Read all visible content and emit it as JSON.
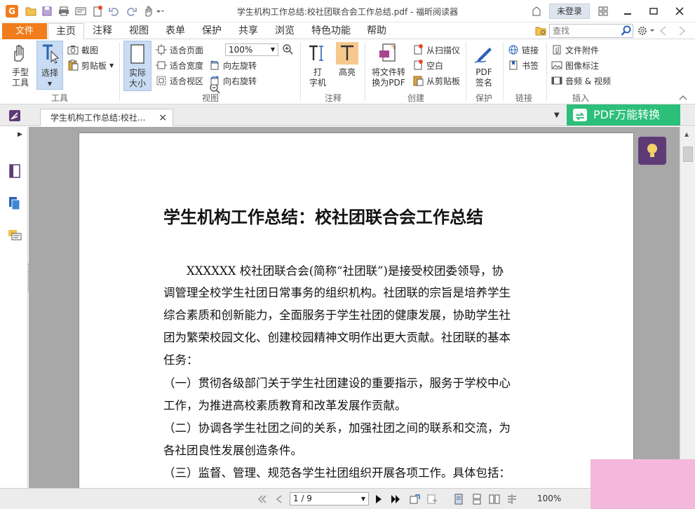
{
  "window": {
    "title": "学生机构工作总结:校社团联合会工作总结.pdf - 福昕阅读器",
    "login_label": "未登录",
    "logo_letter": "G"
  },
  "menu": {
    "file_label": "文件",
    "tabs": [
      {
        "label": "主页",
        "active": true
      },
      {
        "label": "注释",
        "active": false
      },
      {
        "label": "视图",
        "active": false
      },
      {
        "label": "表单",
        "active": false
      },
      {
        "label": "保护",
        "active": false
      },
      {
        "label": "共享",
        "active": false
      },
      {
        "label": "浏览",
        "active": false
      },
      {
        "label": "特色功能",
        "active": false
      },
      {
        "label": "帮助",
        "active": false
      }
    ],
    "search_placeholder": "查找"
  },
  "ribbon": {
    "tools": {
      "group_label": "工具",
      "hand_line1": "手型",
      "hand_line2": "工具",
      "select_label": "选择",
      "screenshot_label": "截图",
      "clipboard_label": "剪贴板"
    },
    "view": {
      "group_label": "视图",
      "actual_size_line1": "实际",
      "actual_size_line2": "大小",
      "fit_page": "适合页面",
      "fit_width": "适合宽度",
      "fit_visible": "适合视区",
      "zoom_value": "100%",
      "rotate_left": "向左旋转",
      "rotate_right": "向右旋转"
    },
    "annotate": {
      "group_label": "注释",
      "typewriter_line1": "打",
      "typewriter_line2": "字机",
      "highlight": "高亮"
    },
    "create": {
      "group_label": "创建",
      "file_to_pdf_line1": "将文件转",
      "file_to_pdf_line2": "换为PDF",
      "from_scanner": "从扫描仪",
      "blank": "空白",
      "from_clipboard": "从剪贴板"
    },
    "protect": {
      "group_label": "保护",
      "pdf_sign_line1": "PDF",
      "pdf_sign_line2": "签名"
    },
    "links": {
      "group_label": "链接",
      "link": "链接",
      "bookmark": "书签"
    },
    "insert": {
      "group_label": "插入",
      "file_attachment": "文件附件",
      "image_annotation": "图像标注",
      "audio_video": "音频 & 视频"
    }
  },
  "doctab": {
    "label": "学生机构工作总结:校社...",
    "close": "×",
    "convert_label": "PDF万能转换"
  },
  "document": {
    "title": "学生机构工作总结：校社团联合会工作总结",
    "lines": [
      "　　XXXXXX 校社团联合会(简称“社团联”)是接受校团委领导，协",
      "调管理全校学生社团日常事务的组织机构。社团联的宗旨是培养学生",
      "综合素质和创新能力，全面服务于学生社团的健康发展，协助学生社",
      "团为繁荣校园文化、创建校园精神文明作出更大贡献。社团联的基本",
      "任务：",
      "（一）贯彻各级部门关于学生社团建设的重要指示，服务于学校中心",
      "工作，为推进高校素质教育和改革发展作贡献。",
      "（二）协调各学生社团之间的关系，加强社团之间的联系和交流，为",
      "各社团良性发展创造条件。",
      "（三）监督、管理、规范各学生社团组织开展各项工作。具体包括："
    ]
  },
  "statusbar": {
    "page_display": "1 / 9",
    "zoom": "100%"
  },
  "colors": {
    "accent_orange": "#f07c1b",
    "convert_green": "#2bbf7a",
    "bulb_purple": "#5e3b77",
    "selected_blue": "#c9dcf3"
  }
}
